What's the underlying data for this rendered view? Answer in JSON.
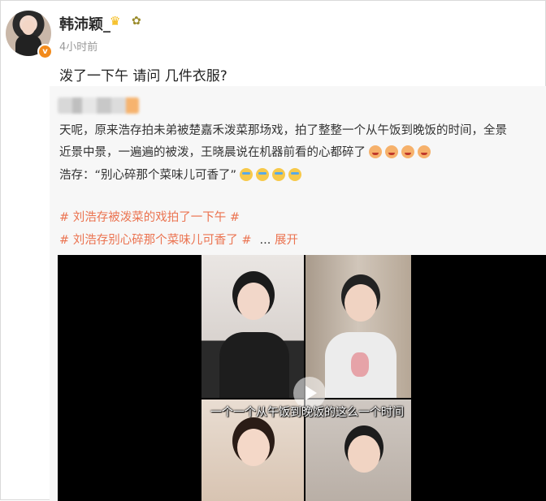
{
  "post": {
    "username": "韩沛颖_",
    "badge_icons": [
      "crown-icon",
      "sunflower-icon"
    ],
    "time": "4小时前",
    "text": "泼了一下午 请问 几件衣服?"
  },
  "repost": {
    "line1": "天呢，原来浩存拍未弟被楚嘉禾泼菜那场戏，拍了整整一个从午饭到晚饭的时间，全景",
    "line2": "近景中景，一遍遍的被泼，王晓晨说在机器前看的心都碎了",
    "line3": "浩存：“别心碎那个菜味儿可香了”",
    "tag1": "# 刘浩存被泼菜的戏拍了一下午 #",
    "tag2": "# 刘浩存别心碎那个菜味儿可香了 #",
    "ellipsis": "...",
    "expand": "展开",
    "video_subtitle": "一个一个从午饭到晚饭的这么一个时间"
  },
  "colors": {
    "accent": "#eb7350",
    "verify": "#f28a1b"
  }
}
